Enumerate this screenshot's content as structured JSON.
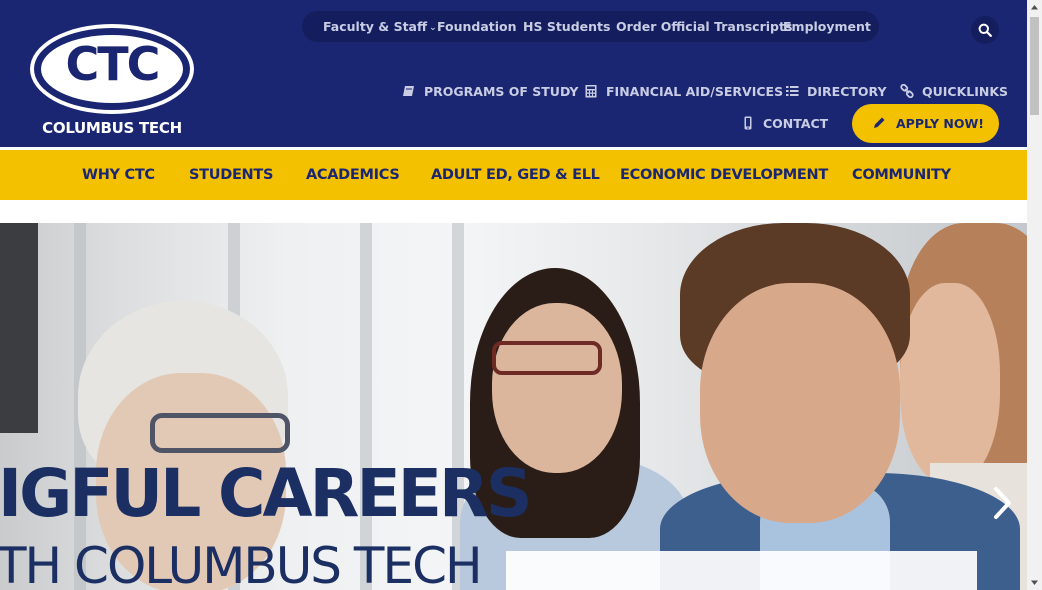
{
  "logo": {
    "monogram": "CTC",
    "name": "COLUMBUS TECH"
  },
  "utility_nav": [
    {
      "label": "Faculty & Staff",
      "has_dropdown": true
    },
    {
      "label": "Foundation"
    },
    {
      "label": "HS Students"
    },
    {
      "label": "Order Official Transcripts"
    },
    {
      "label": "Employment"
    }
  ],
  "search": {
    "icon": "search-icon"
  },
  "secondary_nav": [
    {
      "label": "PROGRAMS OF STUDY",
      "icon": "book-icon"
    },
    {
      "label": "FINANCIAL AID/SERVICES",
      "icon": "calculator-icon"
    },
    {
      "label": "DIRECTORY",
      "icon": "list-icon"
    },
    {
      "label": "QUICKLINKS",
      "icon": "link-icon"
    },
    {
      "label": "CONTACT",
      "icon": "mobile-icon"
    }
  ],
  "apply": {
    "label": "APPLY NOW!",
    "icon": "pencil-icon"
  },
  "main_nav": [
    {
      "label": "WHY CTC"
    },
    {
      "label": "STUDENTS"
    },
    {
      "label": "ACADEMICS"
    },
    {
      "label": "ADULT ED, GED & ELL"
    },
    {
      "label": "ECONOMIC DEVELOPMENT"
    },
    {
      "label": "COMMUNITY"
    }
  ],
  "hero": {
    "headline": "IGFUL CAREERS",
    "subheadline": "TH COLUMBUS TECH",
    "next_icon": "chevron-right-icon"
  },
  "colors": {
    "navy": "#1b2672",
    "gold": "#f3c100",
    "headline": "#1b2f63"
  }
}
